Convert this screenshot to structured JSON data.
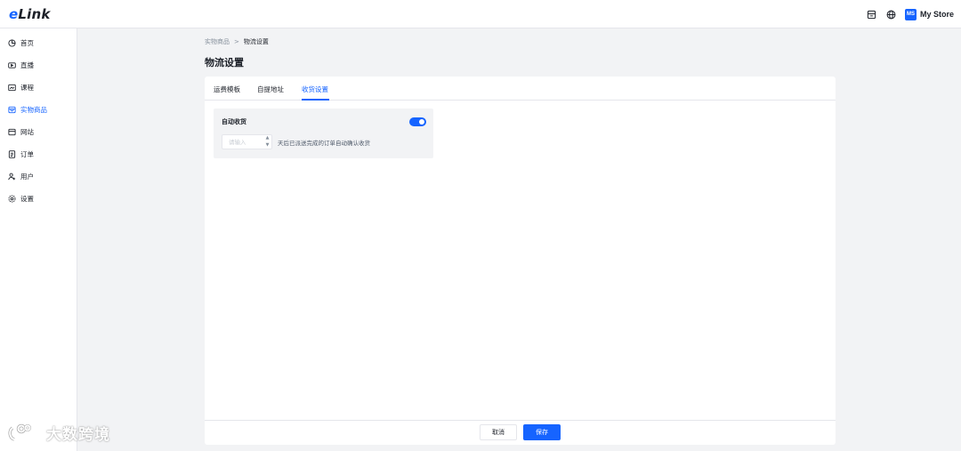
{
  "app": {
    "logo_prefix": "e",
    "logo_text": "Link",
    "brand_color": "#1664ff"
  },
  "header": {
    "store_avatar": "MS",
    "store_name": "My Store",
    "icons": [
      "store-icon",
      "globe-icon"
    ]
  },
  "sidebar": {
    "items": [
      {
        "label": "首页",
        "icon": "dashboard-icon",
        "active": false
      },
      {
        "label": "直播",
        "icon": "live-icon",
        "active": false
      },
      {
        "label": "课程",
        "icon": "course-icon",
        "active": false
      },
      {
        "label": "实物商品",
        "icon": "product-icon",
        "active": true
      },
      {
        "label": "网站",
        "icon": "website-icon",
        "active": false
      },
      {
        "label": "订单",
        "icon": "order-icon",
        "active": false
      },
      {
        "label": "用户",
        "icon": "user-icon",
        "active": false
      },
      {
        "label": "设置",
        "icon": "settings-icon",
        "active": false
      }
    ]
  },
  "breadcrumb": {
    "parent": "实物商品",
    "separator": ">",
    "current": "物流设置"
  },
  "page_title": "物流设置",
  "tabs": [
    {
      "label": "运费模板",
      "active": false
    },
    {
      "label": "自提地址",
      "active": false
    },
    {
      "label": "收货设置",
      "active": true
    }
  ],
  "auto_receive": {
    "title": "自动收货",
    "toggle_on": true,
    "input_placeholder": "请输入",
    "input_value": "",
    "description": "天后已派送完成的订单自动确认收货"
  },
  "footer": {
    "cancel_label": "取消",
    "save_label": "保存"
  },
  "watermark": {
    "text": "大数跨境"
  }
}
